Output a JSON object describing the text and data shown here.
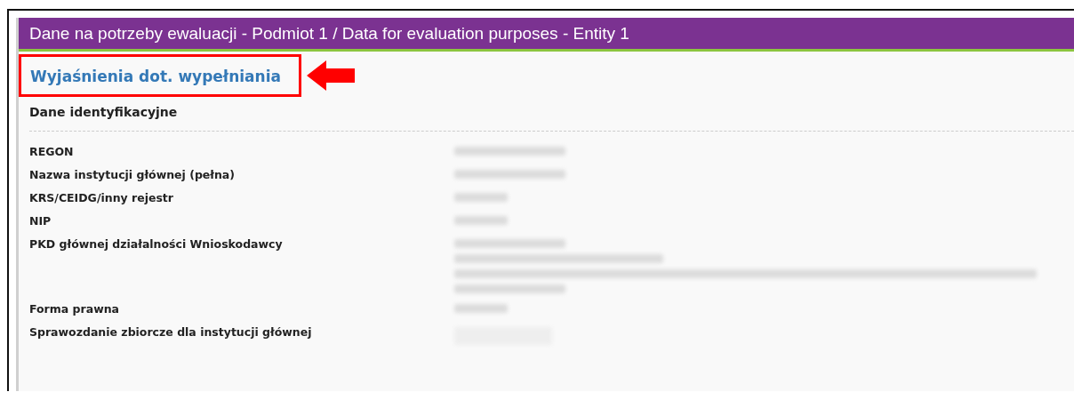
{
  "panel": {
    "title": "Dane na potrzeby ewaluacji - Podmiot 1 / Data for evaluation purposes - Entity 1"
  },
  "help_link": {
    "label": "Wyjaśnienia dot. wypełniania",
    "highlighted": true
  },
  "section": {
    "title": "Dane identyfikacyjne"
  },
  "fields": [
    {
      "label": "REGON",
      "kind": "text",
      "redacted": [
        true
      ]
    },
    {
      "label": "Nazwa instytucji głównej (pełna)",
      "kind": "text",
      "redacted": [
        true
      ]
    },
    {
      "label": "KRS/CEIDG/inny rejestr",
      "kind": "text",
      "redacted": [
        true
      ]
    },
    {
      "label": "NIP",
      "kind": "text",
      "redacted": [
        true
      ]
    },
    {
      "label": "PKD głównej działalności Wnioskodawcy",
      "kind": "text",
      "redacted": [
        true,
        true,
        true,
        true
      ]
    },
    {
      "label": "Forma prawna",
      "kind": "text",
      "redacted": [
        true
      ]
    },
    {
      "label": "Sprawozdanie zbiorcze dla instytucji głównej",
      "kind": "toggle"
    }
  ]
}
